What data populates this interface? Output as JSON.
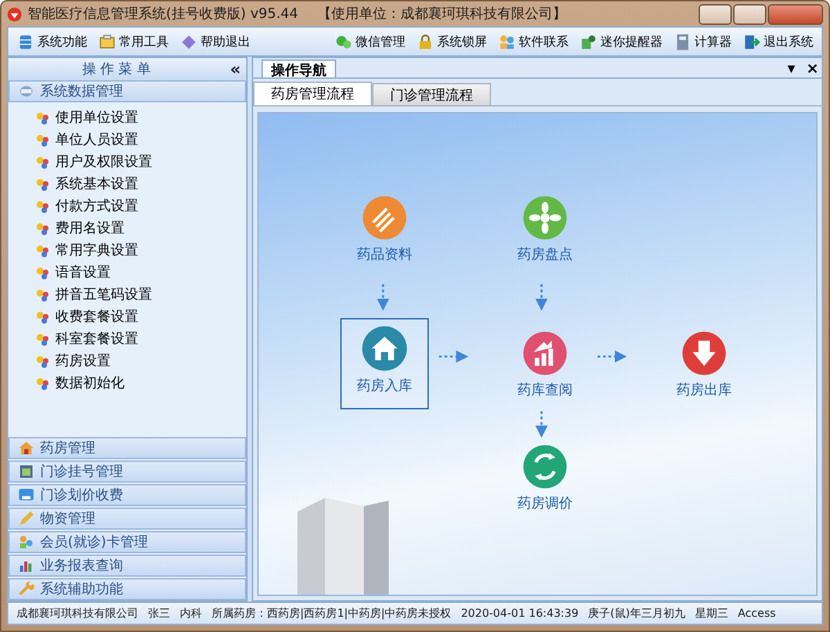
{
  "window": {
    "title": "智能医疗信息管理系统(挂号收费版) v95.44",
    "unit": "【使用单位：成都襄珂琪科技有限公司】"
  },
  "toolbar": {
    "left": [
      {
        "label": "系统功能",
        "kind": "db"
      },
      {
        "label": "常用工具",
        "kind": "tools"
      },
      {
        "label": "帮助退出",
        "kind": "help"
      }
    ],
    "right": [
      {
        "label": "微信管理",
        "kind": "chat"
      },
      {
        "label": "系统锁屏",
        "kind": "lock"
      },
      {
        "label": "软件联系",
        "kind": "people"
      },
      {
        "label": "迷你提醒器",
        "kind": "bell"
      },
      {
        "label": "计算器",
        "kind": "calc"
      },
      {
        "label": "退出系统",
        "kind": "exit"
      }
    ]
  },
  "sidebar": {
    "title": "操 作 菜 单",
    "collapse": "«",
    "open_group": {
      "label": "系统数据管理",
      "expanded": true,
      "children": [
        {
          "label": "使用单位设置"
        },
        {
          "label": "单位人员设置"
        },
        {
          "label": "用户及权限设置"
        },
        {
          "label": "系统基本设置"
        },
        {
          "label": "付款方式设置"
        },
        {
          "label": "费用名设置"
        },
        {
          "label": "常用字典设置"
        },
        {
          "label": "语音设置"
        },
        {
          "label": "拼音五笔码设置"
        },
        {
          "label": "收费套餐设置"
        },
        {
          "label": "科室套餐设置"
        },
        {
          "label": "药房设置"
        },
        {
          "label": "数据初始化"
        }
      ]
    },
    "groups": [
      {
        "label": "药房管理",
        "kind": "house"
      },
      {
        "label": "门诊挂号管理",
        "kind": "register"
      },
      {
        "label": "门诊划价收费",
        "kind": "screen"
      },
      {
        "label": "物资管理",
        "kind": "pencil"
      },
      {
        "label": "会员(就诊)卡管理",
        "kind": "people"
      },
      {
        "label": "业务报表查询",
        "kind": "chart"
      },
      {
        "label": "系统辅助功能",
        "kind": "wrench"
      }
    ]
  },
  "main": {
    "panel_tab": "操作导航",
    "menu_glyph": "▾",
    "close_glyph": "×",
    "tabs": [
      {
        "label": "药房管理流程",
        "selected": true
      },
      {
        "label": "门诊管理流程",
        "selected": false
      }
    ],
    "flow": [
      {
        "label": "药品资料",
        "kind": "doc",
        "color": "#ee8a33",
        "selected": false
      },
      {
        "label": "药房盘点",
        "kind": "flower",
        "color": "#62b947",
        "selected": false
      },
      {
        "label": "药房入库",
        "kind": "house",
        "color": "#2a8aa8",
        "selected": true
      },
      {
        "label": "药库查阅",
        "kind": "chart",
        "color": "#e0506f",
        "selected": false
      },
      {
        "label": "药房出库",
        "kind": "down",
        "color": "#df3d3a",
        "selected": false
      },
      {
        "label": "药房调价",
        "kind": "recycle",
        "color": "#22a678",
        "selected": false
      }
    ]
  },
  "status_bar": [
    "成都襄珂琪科技有限公司",
    "张三",
    "内科",
    "所属药房：西药房|西药房1|中药房|中药房未授权",
    "2020-04-01 16:43:39",
    "庚子(鼠)年三月初九",
    "星期三",
    "Access"
  ]
}
